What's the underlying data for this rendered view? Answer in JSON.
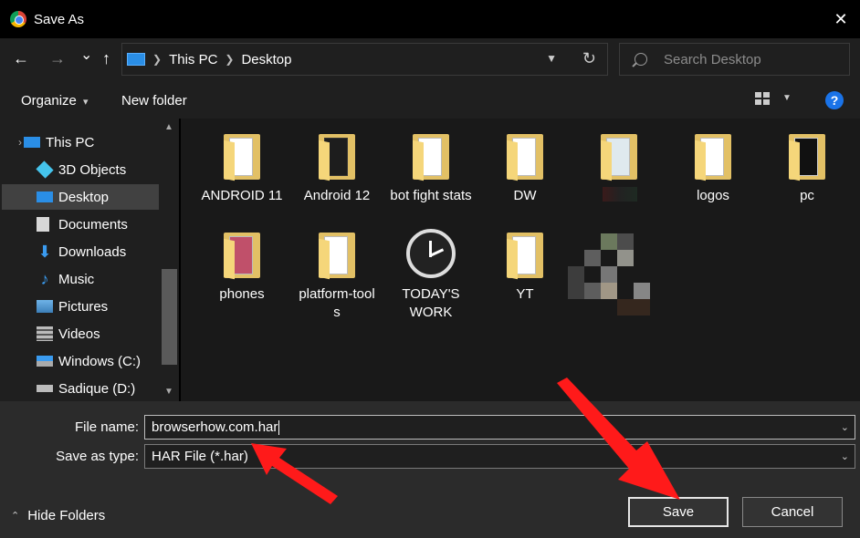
{
  "window": {
    "title": "Save As",
    "close_glyph": "✕"
  },
  "nav": {
    "back_glyph": "←",
    "forward_glyph": "→",
    "recent_glyph": "⌄",
    "up_glyph": "↑",
    "breadcrumb": [
      "This PC",
      "Desktop"
    ],
    "search_placeholder": "Search Desktop"
  },
  "toolbar": {
    "organize_label": "Organize",
    "organize_caret": "▾",
    "new_folder_label": "New folder",
    "help_label": "?"
  },
  "sidebar": {
    "items": [
      {
        "label": "This PC",
        "icon": "pc-icon"
      },
      {
        "label": "3D Objects",
        "icon": "cube-icon"
      },
      {
        "label": "Desktop",
        "icon": "desktop-icon",
        "selected": true
      },
      {
        "label": "Documents",
        "icon": "document-icon"
      },
      {
        "label": "Downloads",
        "icon": "download-icon"
      },
      {
        "label": "Music",
        "icon": "music-icon"
      },
      {
        "label": "Pictures",
        "icon": "picture-icon"
      },
      {
        "label": "Videos",
        "icon": "video-icon"
      },
      {
        "label": "Windows (C:)",
        "icon": "drive-icon"
      },
      {
        "label": "Sadique (D:)",
        "icon": "drive-icon"
      }
    ],
    "expand_glyph": "›"
  },
  "files": [
    {
      "label": "ANDROID 11",
      "icon": "folder-icon"
    },
    {
      "label": "Android 12",
      "icon": "folder-icon"
    },
    {
      "label": "bot fight stats",
      "icon": "folder-icon"
    },
    {
      "label": "DW",
      "icon": "folder-icon"
    },
    {
      "label": "",
      "icon": "folder-icon"
    },
    {
      "label": "logos",
      "icon": "folder-icon"
    },
    {
      "label": "pc",
      "icon": "folder-icon"
    },
    {
      "label": "phones",
      "icon": "folder-icon"
    },
    {
      "label": "platform-tools",
      "icon": "folder-icon"
    },
    {
      "label": "TODAY'S WORK",
      "icon": "clock-icon"
    },
    {
      "label": "YT",
      "icon": "folder-icon"
    }
  ],
  "form": {
    "file_name_label": "File name:",
    "file_name_value": "browserhow.com.har",
    "save_type_label": "Save as type:",
    "save_type_value": "HAR File (*.har)",
    "dropdown_glyph": "⌄"
  },
  "footer": {
    "hide_folders_label": "Hide Folders",
    "hide_folders_glyph": "⌃",
    "save_label": "Save",
    "cancel_label": "Cancel"
  },
  "colors": {
    "accent_blue": "#1a73e8",
    "folder_yellow": "#e2c065",
    "annotation_red": "#ff1a1a"
  }
}
